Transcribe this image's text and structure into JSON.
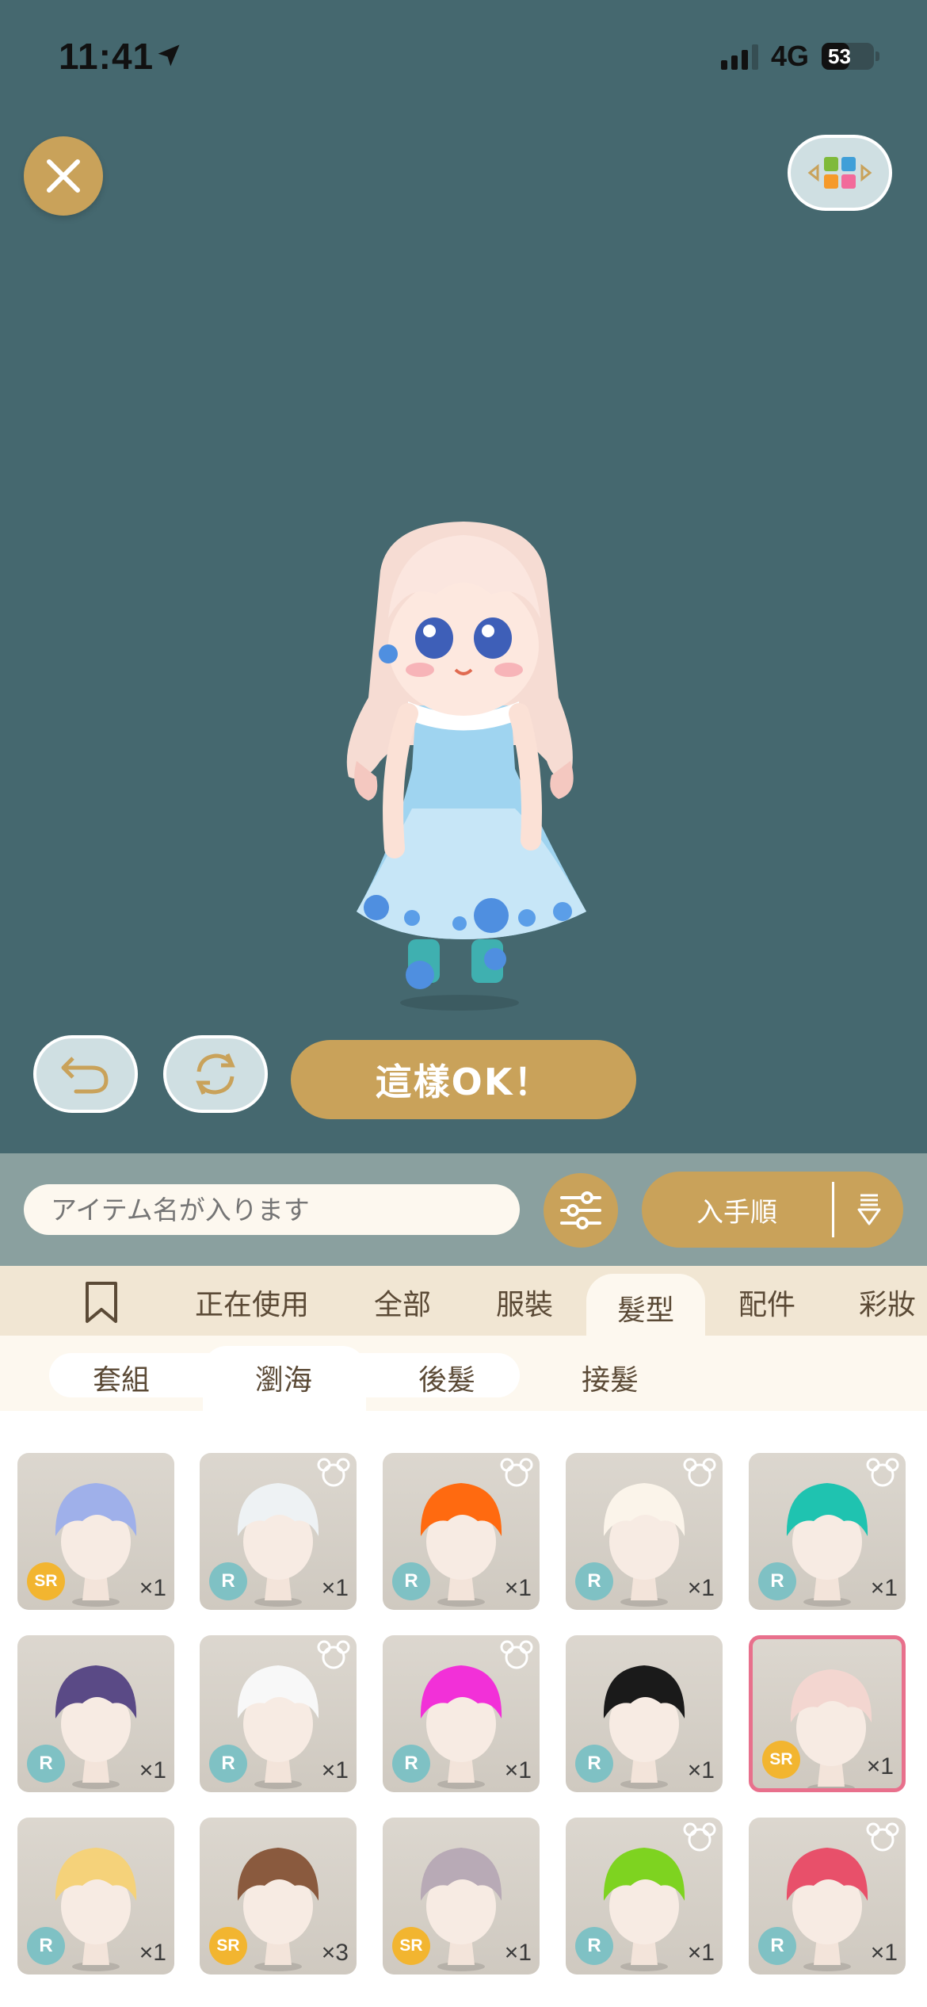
{
  "status": {
    "time": "11:41",
    "network": "4G",
    "battery": "53",
    "battery_level": 0.53
  },
  "actions": {
    "ok_label": "這樣OK！"
  },
  "search": {
    "placeholder": "アイテム名が入ります",
    "sort_label": "入手順"
  },
  "tabs": [
    {
      "label": "正在使用",
      "active": false
    },
    {
      "label": "全部",
      "active": false
    },
    {
      "label": "服裝",
      "active": false
    },
    {
      "label": "髮型",
      "active": true
    },
    {
      "label": "配件",
      "active": false
    },
    {
      "label": "彩妝",
      "active": false
    }
  ],
  "subtabs": [
    {
      "label": "套組",
      "active": false
    },
    {
      "label": "瀏海",
      "active": true
    },
    {
      "label": "後髮",
      "active": false
    },
    {
      "label": "接髮",
      "active": false
    }
  ],
  "items": [
    {
      "rarity": "SR",
      "qty": "×1",
      "hair": "#9fb0ea",
      "bear": false,
      "selected": false
    },
    {
      "rarity": "R",
      "qty": "×1",
      "hair": "#eef2f4",
      "bear": true,
      "selected": false
    },
    {
      "rarity": "R",
      "qty": "×1",
      "hair": "#ff6a10",
      "bear": true,
      "selected": false
    },
    {
      "rarity": "R",
      "qty": "×1",
      "hair": "#fbf4ea",
      "bear": true,
      "selected": false
    },
    {
      "rarity": "R",
      "qty": "×1",
      "hair": "#1fc3b0",
      "bear": true,
      "selected": false
    },
    {
      "rarity": "R",
      "qty": "×1",
      "hair": "#5a4a86",
      "bear": false,
      "selected": false
    },
    {
      "rarity": "R",
      "qty": "×1",
      "hair": "#f8f8f8",
      "bear": true,
      "selected": false
    },
    {
      "rarity": "R",
      "qty": "×1",
      "hair": "#f230d8",
      "bear": true,
      "selected": false
    },
    {
      "rarity": "R",
      "qty": "×1",
      "hair": "#1a1a1a",
      "bear": false,
      "selected": false
    },
    {
      "rarity": "SR",
      "qty": "×1",
      "hair": "#f3d6d0",
      "bear": false,
      "selected": true
    },
    {
      "rarity": "R",
      "qty": "×1",
      "hair": "#f5d27a",
      "bear": false,
      "selected": false
    },
    {
      "rarity": "SR",
      "qty": "×3",
      "hair": "#8a5a3e",
      "bear": false,
      "selected": false
    },
    {
      "rarity": "SR",
      "qty": "×1",
      "hair": "#b8aab6",
      "bear": false,
      "selected": false
    },
    {
      "rarity": "R",
      "qty": "×1",
      "hair": "#7ed320",
      "bear": true,
      "selected": false
    },
    {
      "rarity": "R",
      "qty": "×1",
      "hair": "#e8506a",
      "bear": true,
      "selected": false
    }
  ],
  "colors": {
    "stage": "#45686f",
    "gold": "#c9a25a",
    "selected_border": "#e8708c"
  }
}
